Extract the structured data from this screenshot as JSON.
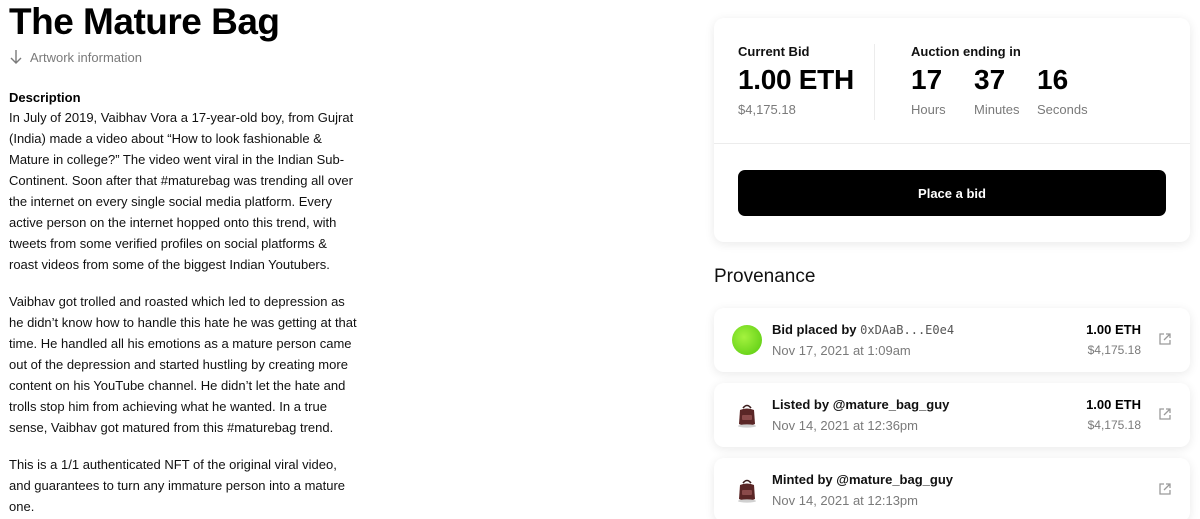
{
  "artwork": {
    "title": "The Mature Bag",
    "info_link": "Artwork information",
    "description_heading": "Description",
    "paragraphs": [
      "In July of 2019, Vaibhav Vora a 17-year-old boy, from Gujrat (India) made a video about “How to look fashionable & Mature in college?” The video went viral in the Indian Sub-Continent. Soon after that #maturebag was trending all over the internet on every single social media platform. Every active person on the internet hopped onto this trend, with tweets from some verified profiles on social platforms & roast videos from some of the biggest Indian Youtubers.",
      "Vaibhav got trolled and roasted which led to depression as he didn’t know how to handle this hate he was getting at that time. He handled all his emotions as a mature person came out of the depression and started hustling by creating more content on his YouTube channel. He didn’t let the hate and trolls stop him from achieving what he wanted. In a true sense, Vaibhav got matured from this #maturebag trend.",
      "This is a 1/1 authenticated NFT of the original viral video, and guarantees to turn any immature person into a mature one."
    ]
  },
  "bid": {
    "current_label": "Current Bid",
    "amount": "1.00 ETH",
    "usd": "$4,175.18",
    "auction_label": "Auction ending in",
    "hours": "17",
    "hours_label": "Hours",
    "minutes": "37",
    "minutes_label": "Minutes",
    "seconds": "16",
    "seconds_label": "Seconds",
    "button": "Place a bid"
  },
  "provenance": {
    "heading": "Provenance",
    "items": [
      {
        "action": "Bid placed by",
        "actor": "0xDAaB...E0e4",
        "date": "Nov 17, 2021 at 1:09am",
        "eth": "1.00 ETH",
        "usd": "$4,175.18"
      },
      {
        "action": "Listed by",
        "actor": "@mature_bag_guy",
        "date": "Nov 14, 2021 at 12:36pm",
        "eth": "1.00 ETH",
        "usd": "$4,175.18"
      },
      {
        "action": "Minted by",
        "actor": "@mature_bag_guy",
        "date": "Nov 14, 2021 at 12:13pm"
      }
    ]
  }
}
